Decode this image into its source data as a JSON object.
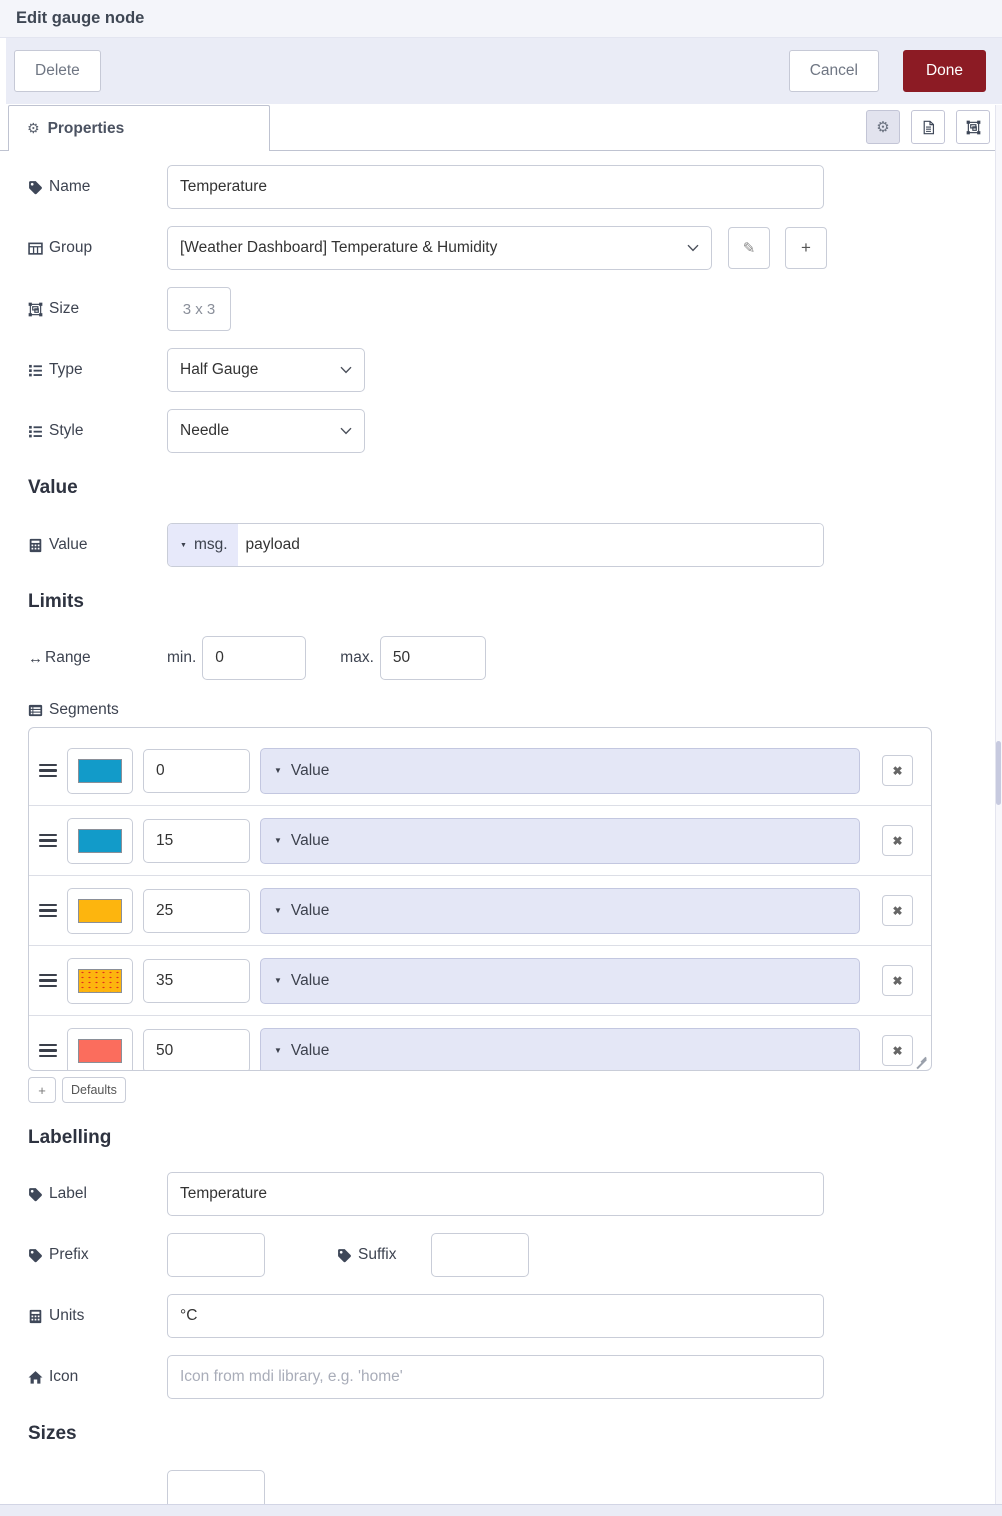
{
  "dialog": {
    "title": "Edit gauge node",
    "delete_label": "Delete",
    "cancel_label": "Cancel",
    "done_label": "Done"
  },
  "tab": {
    "label": "Properties"
  },
  "glyphs": {
    "gear": "⚙",
    "pencil": "✎",
    "plus": "+",
    "close": "✖",
    "caret_down": "▼",
    "arrows_h": "↔"
  },
  "colors": {
    "done_button_bg": "#8C1B24",
    "typed_input_bg": "#e7e9fa",
    "segment_dropdown_bg": "#e4e7f6"
  },
  "fields": {
    "name": {
      "label": "Name",
      "value": "Temperature"
    },
    "group": {
      "label": "Group",
      "value": "[Weather Dashboard] Temperature & Humidity"
    },
    "size": {
      "label": "Size",
      "value": "3 x 3"
    },
    "type": {
      "label": "Type",
      "value": "Half Gauge"
    },
    "style": {
      "label": "Style",
      "value": "Needle"
    }
  },
  "value_section": {
    "heading": "Value",
    "field_label": "Value",
    "prop_prefix": "msg.",
    "prop_value": "payload"
  },
  "limits_section": {
    "heading": "Limits",
    "range_label": "Range",
    "min_label": "min.",
    "min_value": "0",
    "max_label": "max.",
    "max_value": "50",
    "segments_label": "Segments",
    "segments": [
      {
        "color": "#129bc9",
        "value": "0",
        "mode": "Value"
      },
      {
        "color": "#129bc9",
        "value": "15",
        "mode": "Value"
      },
      {
        "color": "#fdb50e",
        "value": "25",
        "mode": "Value"
      },
      {
        "color": "#fdb50e",
        "value": "35",
        "mode": "Value",
        "speckled": true
      },
      {
        "color": "#fb6d5d",
        "value": "50",
        "mode": "Value"
      }
    ],
    "defaults_label": "Defaults"
  },
  "labelling_section": {
    "heading": "Labelling",
    "label_field": {
      "label": "Label",
      "value": "Temperature"
    },
    "prefix_field": {
      "label": "Prefix",
      "value": ""
    },
    "suffix_field": {
      "label": "Suffix",
      "value": ""
    },
    "units_field": {
      "label": "Units",
      "value": "°C"
    },
    "icon_field": {
      "label": "Icon",
      "placeholder": "Icon from mdi library, e.g. 'home'"
    }
  },
  "sizes_section": {
    "heading": "Sizes"
  }
}
